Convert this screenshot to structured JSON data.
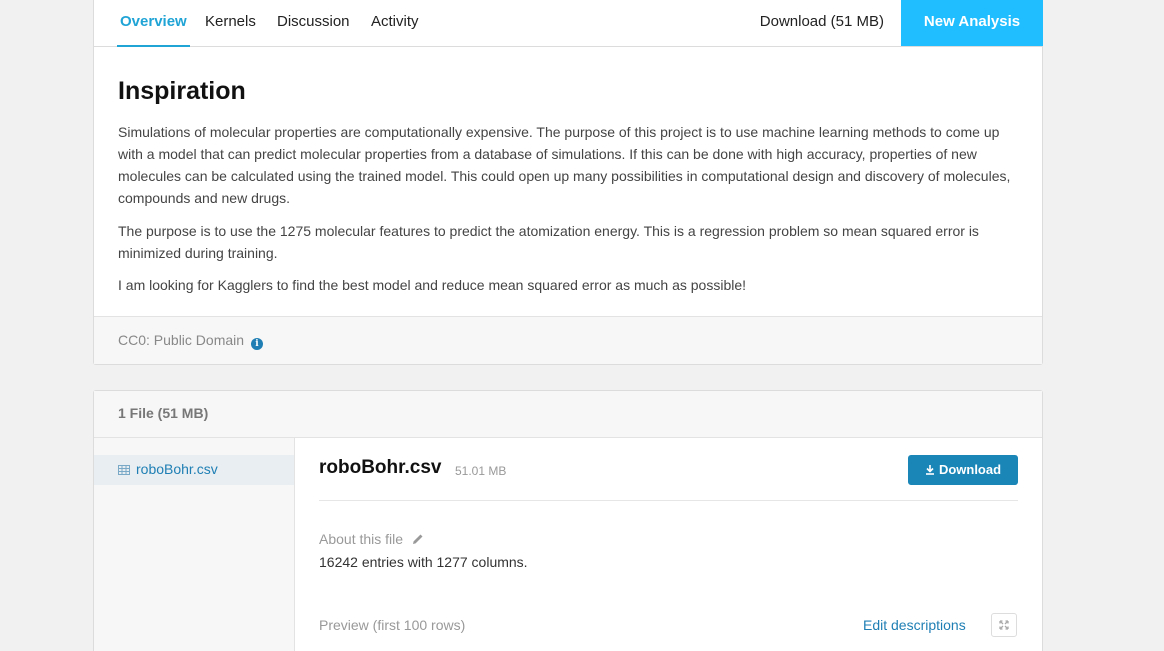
{
  "nav": {
    "tabs": [
      {
        "label": "Overview"
      },
      {
        "label": "Kernels"
      },
      {
        "label": "Discussion"
      },
      {
        "label": "Activity"
      }
    ],
    "download_label": "Download (51 MB)",
    "new_analysis_label": "New Analysis"
  },
  "inspiration": {
    "heading": "Inspiration",
    "paragraphs": [
      "Simulations of molecular properties are computationally expensive. The purpose of this project is to use machine learning methods to come up with a model that can predict molecular properties from a database of simulations. If this can be done with high accuracy, properties of new molecules can be calculated using the trained model. This could open up many possibilities in computational design and discovery of molecules, compounds and new drugs.",
      "The purpose is to use the 1275 molecular features to predict the atomization energy. This is a regression problem so mean squared error is minimized during training.",
      "I am looking for Kagglers to find the best model and reduce mean squared error as much as possible!"
    ],
    "license": "CC0: Public Domain"
  },
  "files": {
    "header": "1 File (51 MB)",
    "sidebar_items": [
      {
        "label": "roboBohr.csv"
      }
    ],
    "selected": {
      "name": "roboBohr.csv",
      "size": "51.01 MB",
      "download_label": "Download",
      "about_label": "About this file",
      "description": "16242 entries with 1277 columns.",
      "preview_label": "Preview (first 100 rows)",
      "edit_label": "Edit descriptions"
    }
  },
  "colors": {
    "accent": "#20a4d6",
    "new_analysis_bg": "#20beff",
    "download_btn_bg": "#1a86b8",
    "link": "#1f7fb4"
  }
}
